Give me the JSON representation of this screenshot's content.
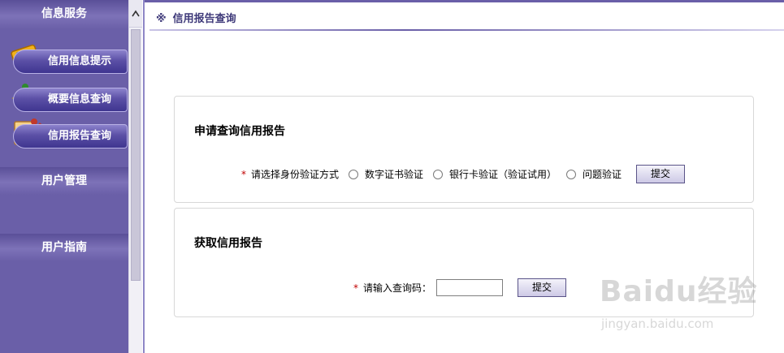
{
  "sidebar": {
    "sections": [
      {
        "title": "信息服务"
      },
      {
        "title": "用户管理"
      },
      {
        "title": "用户指南"
      }
    ],
    "items": [
      {
        "label": "信用信息提示"
      },
      {
        "label": "概要信息查询"
      },
      {
        "label": "信用报告查询"
      }
    ]
  },
  "header": {
    "marker": "※",
    "title": "信用报告查询"
  },
  "apply_panel": {
    "title": "申请查询信用报告",
    "required_mark": "*",
    "prompt": "请选择身份验证方式",
    "options": [
      {
        "label": "数字证书验证"
      },
      {
        "label": "银行卡验证（验证试用）"
      },
      {
        "label": "问题验证"
      }
    ],
    "submit_label": "提交"
  },
  "get_panel": {
    "title": "获取信用报告",
    "required_mark": "*",
    "prompt": "请输入查询码：",
    "input_value": "",
    "submit_label": "提交"
  },
  "watermark": {
    "text": "Baidu经验",
    "sub": "jingyan.baidu.com"
  },
  "colors": {
    "sidebar": "#6a5fa8",
    "accent": "#3f3a7a",
    "required": "#c00000"
  }
}
